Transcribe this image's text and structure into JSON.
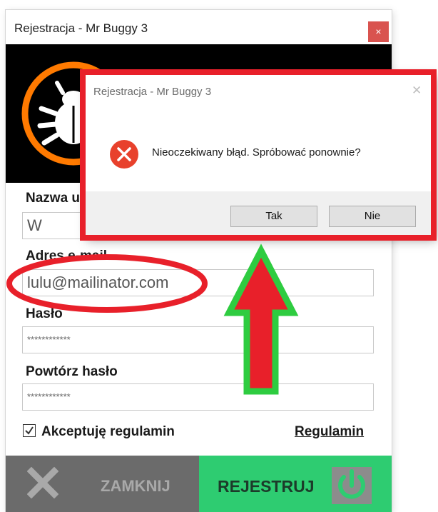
{
  "window": {
    "title": "Rejestracja - Mr Buggy 3",
    "close_glyph": "×"
  },
  "form": {
    "username_label": "Nazwa u",
    "username_value": "W",
    "email_label": "Adres e-mail",
    "email_value": "lulu@mailinator.com",
    "password_label": "Hasło",
    "password_value": "************",
    "repeat_label": "Powtórz hasło",
    "repeat_value": "************",
    "accept_label": "Akceptuję regulamin",
    "regulamin_link": "Regulamin"
  },
  "footer": {
    "close_label": "ZAMKNIJ",
    "register_label": "REJESTRUJ"
  },
  "dialog": {
    "title": "Rejestracja - Mr Buggy 3",
    "close_glyph": "✕",
    "message": "Nieoczekiwany błąd. Spróbować ponownie?",
    "yes_label": "Tak",
    "no_label": "Nie"
  },
  "colors": {
    "close_button": "#d9534f",
    "register_bg": "#2ecc71",
    "close_bg": "#6b6b6b",
    "annotation_red": "#e8202a",
    "annotation_green": "#2ecc40",
    "logo_orange": "#ff7a00"
  }
}
